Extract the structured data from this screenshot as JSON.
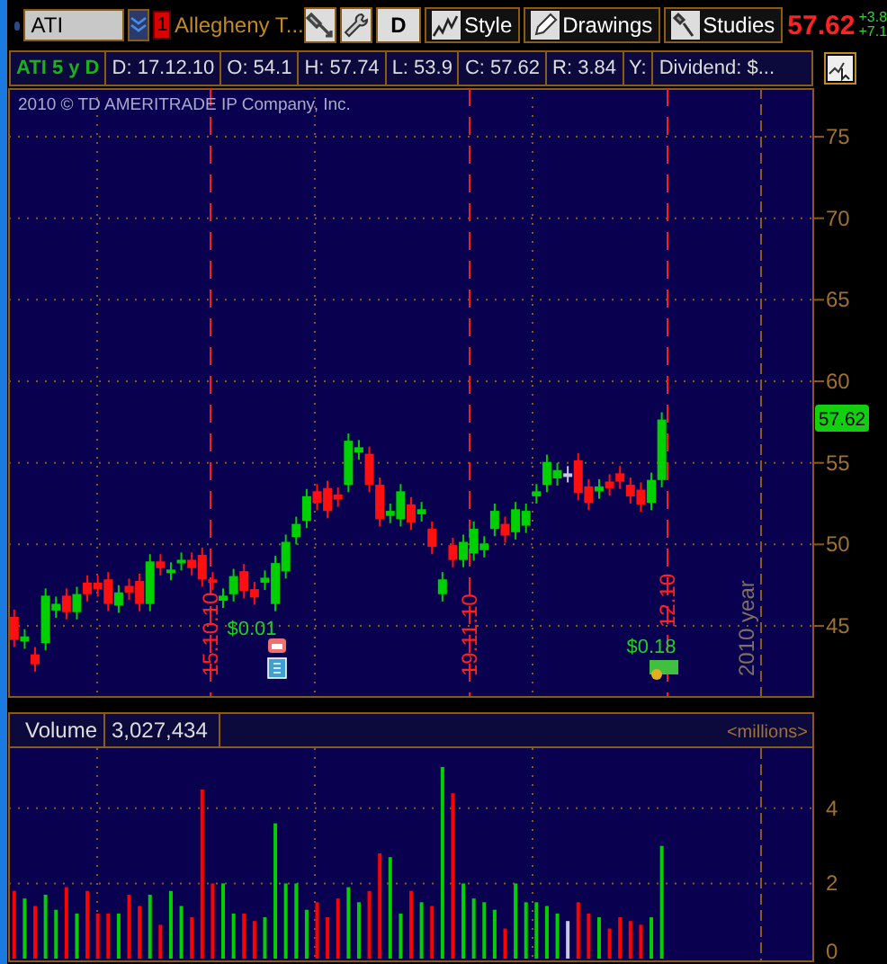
{
  "toolbar": {
    "symbol": "ATI",
    "alert_badge": "1",
    "company": "Allegheny T...",
    "buttons": [
      {
        "kind": "plain",
        "label": "D"
      },
      {
        "kind": "with-icon",
        "label": "Style"
      },
      {
        "kind": "with-icon",
        "label": "Drawings"
      },
      {
        "kind": "with-icon",
        "label": "Studies"
      }
    ],
    "last_price": "57.62",
    "change": [
      "+3.8",
      "+7.1"
    ]
  },
  "info_bar": {
    "title": "ATI 5 y D",
    "fields": [
      "D: 17.12.10",
      "O: 54.1",
      "H: 57.74",
      "L: 53.9",
      "C: 57.62",
      "R: 3.84",
      "Y:",
      "Dividend: $..."
    ]
  },
  "price_chart": {
    "copyright": "2010 © TD AMERITRADE IP Company, Inc.",
    "last_price_badge": "57.62",
    "date_markers": [
      "15.10.10",
      "19.11.10",
      "12.10"
    ],
    "period_label": "2010 year",
    "events": [
      {
        "kind": "earnings",
        "label": "$0.01"
      },
      {
        "kind": "dividend",
        "label": "$0.18"
      }
    ],
    "chart_data": {
      "type": "candlestick",
      "grid": true,
      "yticks": [
        75,
        70,
        65,
        60,
        55,
        50,
        45
      ],
      "ylim": [
        40.7,
        77.98
      ],
      "categories": [
        null,
        null,
        null,
        null,
        null,
        null,
        null,
        null,
        null,
        null,
        null,
        null,
        null,
        null,
        null,
        null,
        null,
        null,
        null,
        null,
        null,
        null,
        null,
        null,
        null,
        null,
        null,
        null,
        null,
        null,
        null,
        null,
        null,
        null,
        null,
        null,
        null,
        null,
        null,
        null,
        null,
        null,
        null,
        null,
        null,
        null,
        null,
        null,
        null,
        null,
        null,
        null,
        null,
        null,
        null,
        null,
        null,
        null,
        null,
        null,
        null,
        null,
        null,
        null,
        null,
        null,
        null,
        null,
        null,
        null,
        null,
        null,
        null,
        null,
        null,
        null,
        null
      ],
      "ohlc": [
        [
          45.5,
          46.0,
          43.7,
          44.2
        ],
        [
          44.1,
          44.8,
          43.6,
          44.3
        ],
        [
          43.2,
          43.7,
          42.2,
          42.7
        ],
        [
          44.0,
          47.3,
          43.5,
          46.8
        ],
        [
          46.0,
          46.8,
          45.5,
          46.3
        ],
        [
          46.8,
          47.3,
          45.4,
          45.9
        ],
        [
          45.9,
          47.4,
          45.4,
          46.9
        ],
        [
          47.6,
          48.1,
          46.5,
          47.0
        ],
        [
          47.6,
          48.1,
          46.8,
          47.3
        ],
        [
          47.8,
          48.3,
          45.9,
          46.4
        ],
        [
          46.3,
          47.5,
          45.8,
          47.0
        ],
        [
          47.4,
          47.9,
          46.6,
          47.1
        ],
        [
          47.7,
          48.2,
          45.9,
          46.4
        ],
        [
          46.4,
          49.4,
          45.9,
          48.9
        ],
        [
          48.9,
          49.4,
          48.1,
          48.6
        ],
        [
          48.3,
          48.9,
          47.8,
          48.4
        ],
        [
          48.9,
          49.5,
          48.4,
          49.0
        ],
        [
          49.0,
          49.5,
          48.1,
          48.6
        ],
        [
          49.3,
          49.8,
          47.4,
          47.9
        ],
        [
          47.8,
          48.3,
          47.2,
          47.7
        ],
        [
          46.6,
          47.3,
          46.1,
          46.8
        ],
        [
          47.0,
          48.5,
          46.5,
          48.0
        ],
        [
          48.3,
          48.8,
          46.7,
          47.2
        ],
        [
          47.2,
          47.7,
          46.3,
          46.8
        ],
        [
          47.7,
          48.4,
          47.2,
          47.9
        ],
        [
          46.4,
          49.3,
          45.9,
          48.8
        ],
        [
          48.4,
          50.6,
          47.9,
          50.1
        ],
        [
          50.5,
          51.7,
          50.0,
          51.2
        ],
        [
          51.5,
          53.4,
          51.0,
          52.9
        ],
        [
          53.2,
          53.7,
          52.1,
          52.6
        ],
        [
          53.4,
          53.9,
          51.6,
          52.1
        ],
        [
          53.0,
          53.5,
          52.3,
          52.8
        ],
        [
          53.7,
          56.8,
          53.2,
          56.3
        ],
        [
          55.7,
          56.4,
          55.2,
          55.9
        ],
        [
          55.5,
          56.0,
          53.2,
          53.7
        ],
        [
          53.6,
          54.1,
          51.1,
          51.6
        ],
        [
          51.8,
          52.5,
          51.3,
          52.0
        ],
        [
          51.6,
          53.7,
          51.1,
          53.2
        ],
        [
          52.4,
          52.9,
          50.9,
          51.4
        ],
        [
          51.9,
          52.6,
          51.4,
          52.1
        ],
        [
          50.9,
          51.4,
          49.4,
          49.9
        ],
        [
          47.0,
          48.3,
          46.5,
          47.8
        ],
        [
          49.9,
          50.4,
          48.6,
          49.1
        ],
        [
          49.1,
          50.6,
          48.6,
          50.1
        ],
        [
          49.5,
          51.4,
          49.0,
          50.9
        ],
        [
          49.7,
          50.5,
          49.2,
          50.0
        ],
        [
          51.0,
          52.5,
          50.5,
          52.0
        ],
        [
          51.2,
          51.7,
          50.1,
          50.6
        ],
        [
          50.8,
          52.6,
          50.3,
          52.1
        ],
        [
          51.2,
          52.5,
          50.7,
          52.0
        ],
        [
          53.0,
          53.7,
          52.5,
          53.2
        ],
        [
          53.7,
          55.5,
          53.2,
          55.0
        ],
        [
          54.1,
          55.0,
          53.6,
          54.5
        ],
        [
          54.3,
          54.8,
          53.8,
          54.3
        ],
        [
          55.1,
          55.6,
          52.7,
          53.2
        ],
        [
          53.5,
          54.0,
          52.1,
          52.6
        ],
        [
          53.3,
          54.0,
          52.8,
          53.5
        ],
        [
          53.8,
          54.3,
          53.0,
          53.5
        ],
        [
          54.3,
          54.8,
          53.4,
          53.9
        ],
        [
          53.6,
          54.1,
          52.5,
          53.0
        ],
        [
          53.3,
          53.8,
          52.0,
          52.5
        ],
        [
          52.6,
          54.4,
          52.1,
          53.9
        ],
        [
          54.0,
          58.1,
          53.5,
          57.6
        ],
        null,
        null,
        null,
        null,
        null,
        null,
        null,
        null,
        null,
        null,
        null,
        null,
        null,
        null
      ]
    }
  },
  "volume": {
    "label": "Volume",
    "value": "3,027,434",
    "chart_data": {
      "type": "bar",
      "stacked": true,
      "grid": true,
      "ylabel": "<millions>",
      "yticks": [
        0,
        2,
        4
      ],
      "ylim": [
        0,
        5.6
      ],
      "categories": [
        null,
        null,
        null,
        null,
        null,
        null,
        null,
        null,
        null,
        null,
        null,
        null,
        null,
        null,
        null,
        null,
        null,
        null,
        null,
        null,
        null,
        null,
        null,
        null,
        null,
        null,
        null,
        null,
        null,
        null,
        null,
        null,
        null,
        null,
        null,
        null,
        null,
        null,
        null,
        null,
        null,
        null,
        null,
        null,
        null,
        null,
        null,
        null,
        null,
        null,
        null,
        null,
        null,
        null,
        null,
        null,
        null,
        null,
        null,
        null,
        null,
        null,
        null,
        null,
        null,
        null,
        null,
        null,
        null,
        null,
        null,
        null,
        null,
        null,
        null,
        null,
        null
      ],
      "series": [
        {
          "color": "#00d000",
          "values": [
            null,
            1.6,
            null,
            1.7,
            1.3,
            null,
            1.2,
            null,
            null,
            null,
            1.2,
            null,
            null,
            1.7,
            null,
            1.8,
            1.4,
            null,
            null,
            null,
            2.0,
            1.2,
            null,
            null,
            1.1,
            3.6,
            2.0,
            2.0,
            1.3,
            null,
            null,
            null,
            1.9,
            1.5,
            null,
            null,
            2.7,
            1.2,
            null,
            1.5,
            null,
            5.1,
            null,
            2.0,
            1.6,
            1.5,
            1.3,
            null,
            2.0,
            1.5,
            1.5,
            1.4,
            1.2,
            null,
            null,
            null,
            1.1,
            null,
            null,
            null,
            null,
            1.1,
            3.0,
            null,
            null,
            null,
            null,
            null,
            null,
            null,
            null,
            null,
            null,
            null,
            null,
            null,
            null
          ]
        },
        {
          "color": "#ff0000",
          "values": [
            1.8,
            null,
            1.4,
            null,
            null,
            1.9,
            null,
            1.8,
            1.2,
            1.2,
            null,
            1.7,
            1.4,
            null,
            0.9,
            null,
            null,
            1.1,
            4.5,
            2.0,
            null,
            null,
            1.2,
            1.0,
            null,
            null,
            null,
            null,
            null,
            1.5,
            1.1,
            1.6,
            null,
            null,
            1.8,
            2.8,
            null,
            null,
            1.8,
            null,
            1.4,
            null,
            4.4,
            null,
            null,
            null,
            null,
            0.8,
            null,
            null,
            null,
            null,
            null,
            null,
            1.5,
            1.2,
            null,
            0.8,
            1.1,
            1.0,
            0.9,
            null,
            null,
            null,
            null,
            null,
            null,
            null,
            null,
            null,
            null,
            null,
            null,
            null,
            null,
            null,
            null
          ]
        },
        {
          "color": "#c8c8e0",
          "values": [
            null,
            null,
            null,
            null,
            null,
            null,
            null,
            null,
            null,
            null,
            null,
            null,
            null,
            null,
            null,
            null,
            null,
            null,
            null,
            null,
            null,
            null,
            null,
            null,
            null,
            null,
            null,
            null,
            null,
            null,
            null,
            null,
            null,
            null,
            null,
            null,
            null,
            null,
            null,
            null,
            null,
            null,
            null,
            null,
            null,
            null,
            null,
            null,
            null,
            null,
            null,
            null,
            null,
            1.0,
            null,
            null,
            null,
            null,
            null,
            null,
            null,
            null,
            null,
            null,
            null,
            null,
            null,
            null,
            null,
            null,
            null,
            null,
            null,
            null,
            null,
            null,
            null
          ]
        }
      ]
    }
  }
}
